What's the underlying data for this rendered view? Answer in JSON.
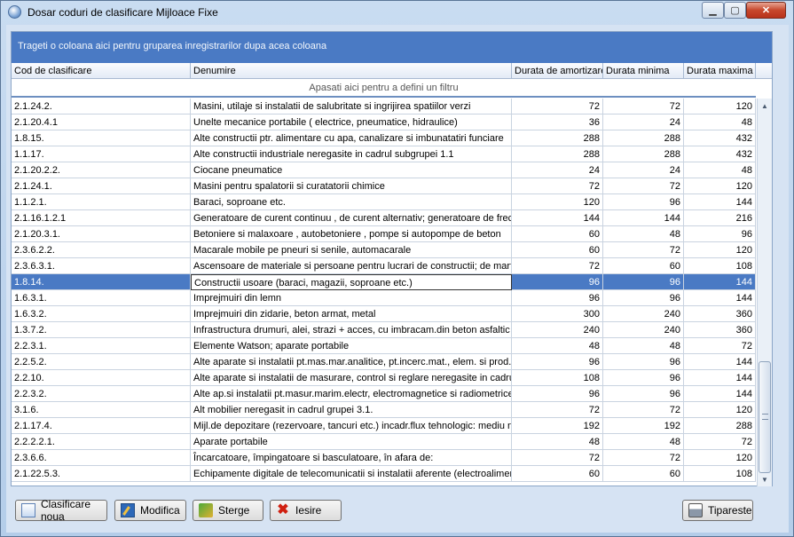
{
  "window": {
    "title": "Dosar coduri de clasificare Mijloace Fixe",
    "min_glyph": "▁",
    "max_glyph": "▢",
    "close_glyph": "✕"
  },
  "grid": {
    "group_hint": "Trageti o coloana aici pentru gruparea inregistrarilor dupa acea coloana",
    "filter_hint": "Apasati aici pentru a defini un filtru",
    "columns": [
      "Cod de clasificare",
      "Denumire",
      "Durata de amortizare",
      "Durata minima",
      "Durata maxima"
    ],
    "selected_index": 11,
    "rows": [
      [
        "2.1.24.2.",
        "Masini, utilaje si instalatii de salubritate si ingrijirea spatiilor verzi",
        "72",
        "72",
        "120"
      ],
      [
        "2.1.20.4.1",
        "Unelte mecanice portabile ( electrice, pneumatice, hidraulice)",
        "36",
        "24",
        "48"
      ],
      [
        "1.8.15.",
        "Alte constructii ptr. alimentare cu apa, canalizare si imbunatatiri funciare",
        "288",
        "288",
        "432"
      ],
      [
        "1.1.17.",
        "Alte constructii industriale neregasite in cadrul subgrupei 1.1",
        "288",
        "288",
        "432"
      ],
      [
        "2.1.20.2.2.",
        "Ciocane pneumatice",
        "24",
        "24",
        "48"
      ],
      [
        "2.1.24.1.",
        "Masini pentru spalatorii si curatatorii chimice",
        "72",
        "72",
        "120"
      ],
      [
        "1.1.2.1.",
        "Baraci, soproane etc.",
        "120",
        "96",
        "144"
      ],
      [
        "2.1.16.1.2.1",
        "Generatoare de curent continuu , de curent alternativ; generatoare de frecv",
        "144",
        "144",
        "216"
      ],
      [
        "2.1.20.3.1.",
        "Betoniere si malaxoare , autobetoniere , pompe si autopompe de beton",
        "60",
        "48",
        "96"
      ],
      [
        "2.3.6.2.2.",
        "Macarale mobile pe pneuri si senile, automacarale",
        "60",
        "72",
        "120"
      ],
      [
        "2.3.6.3.1.",
        "Ascensoare de materiale si persoane pentru lucrari de constructii; de marfuri.",
        "72",
        "60",
        "108"
      ],
      [
        "1.8.14.",
        "Constructii usoare (baraci, magazii, soproane etc.)",
        "96",
        "96",
        "144"
      ],
      [
        "1.6.3.1.",
        "Imprejmuiri din lemn",
        "96",
        "96",
        "144"
      ],
      [
        "1.6.3.2.",
        "Imprejmuiri din zidarie, beton armat, metal",
        "300",
        "240",
        "360"
      ],
      [
        "1.3.7.2.",
        "Infrastructura drumuri, alei, strazi + acces, cu imbracam.din beton asfaltic si p",
        "240",
        "240",
        "360"
      ],
      [
        "2.2.3.1.",
        "Elemente Watson; aparate portabile",
        "48",
        "48",
        "72"
      ],
      [
        "2.2.5.2.",
        "Alte aparate si instalatii pt.mas.mar.analitice, pt.incerc.mat., elem. si prod.ner",
        "96",
        "96",
        "144"
      ],
      [
        "2.2.10.",
        "Alte aparate si instalatii de masurare, control si reglare neregasite in cadrul su",
        "108",
        "96",
        "144"
      ],
      [
        "2.2.3.2.",
        "Alte ap.si instalatii pt.masur.marim.electr, electromagnetice si radiometrice ne",
        "96",
        "96",
        "144"
      ],
      [
        "3.1.6.",
        "Alt mobilier neregasit in cadrul grupei 3.1.",
        "72",
        "72",
        "120"
      ],
      [
        "2.1.17.4.",
        "Mijl.de depozitare (rezervoare, tancuri etc.) incadr.flux tehnologic: mediu neu",
        "192",
        "192",
        "288"
      ],
      [
        "2.2.2.2.1.",
        "Aparate portabile",
        "48",
        "48",
        "72"
      ],
      [
        "2.3.6.6.",
        "Încarcatoare, împingatoare si basculatoare, în afara de:",
        "72",
        "72",
        "120"
      ],
      [
        "2.1.22.5.3.",
        "Echipamente digitale de telecomunicatii si instalatii aferente (electroalimentar",
        "60",
        "60",
        "108"
      ]
    ]
  },
  "buttons": {
    "new": "Clasificare noua",
    "edit": "Modifica",
    "delete": "Sterge",
    "exit": "Iesire",
    "print": "Tipareste"
  },
  "colors": {
    "accent": "#4a7ac4",
    "selected_row": "#4a7ac4"
  }
}
